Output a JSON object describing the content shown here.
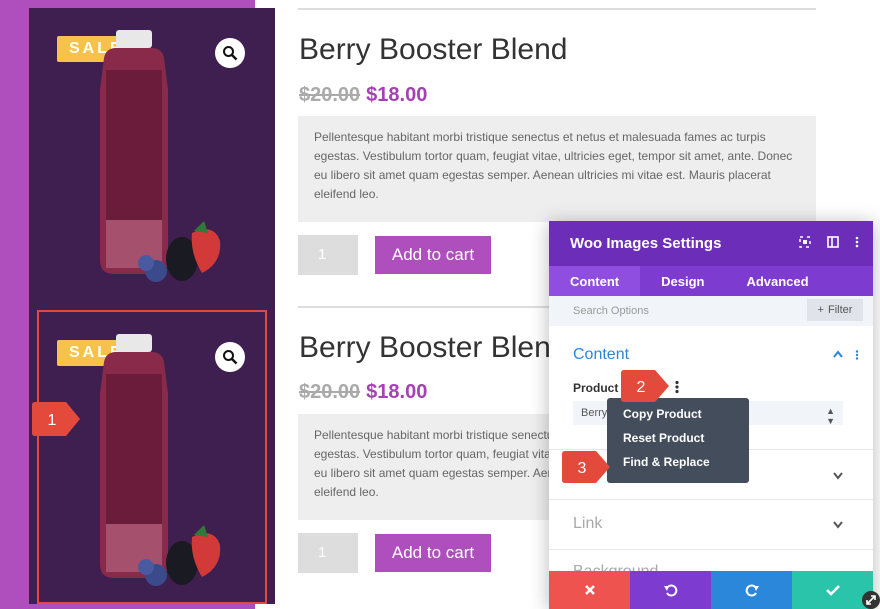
{
  "products": [
    {
      "title": "Berry Booster Blend",
      "old_price": "$20.00",
      "new_price": "$18.00",
      "sale_label": "SALE!",
      "description": "Pellentesque habitant morbi tristique senectus et netus et malesuada fames ac turpis egestas. Vestibulum tortor quam, feugiat vitae, ultricies eget, tempor sit amet, ante. Donec eu libero sit amet quam egestas semper. Aenean ultricies mi vitae est. Mauris placerat eleifend leo.",
      "quantity": "1",
      "add_to_cart": "Add to cart"
    },
    {
      "title": "Berry Booster Blend",
      "old_price": "$20.00",
      "new_price": "$18.00",
      "sale_label": "SALE!",
      "description": "Pellentesque habitant morbi tristique senectus et netus et malesuada fames ac turpis egestas. Vestibulum tortor quam, feugiat vitae, ultricies eget, tempor sit amet, ante. Donec eu libero sit amet quam egestas semper. Aenean ultricies mi vitae est. Mauris placerat eleifend leo.",
      "quantity": "1",
      "add_to_cart": "Add to cart"
    }
  ],
  "settings_panel": {
    "title": "Woo Images Settings",
    "tabs": [
      "Content",
      "Design",
      "Advanced"
    ],
    "active_tab": "Content",
    "search_placeholder": "Search Options",
    "filter_label": "Filter",
    "sections": {
      "content_title": "Content",
      "product_label": "Product",
      "product_value": "Berry",
      "link_title": "Link",
      "background_title": "Background"
    },
    "footer_icons": [
      "close-icon",
      "undo-icon",
      "redo-icon",
      "check-icon"
    ]
  },
  "context_menu": {
    "items": [
      "Copy Product",
      "Reset Product",
      "Find & Replace"
    ]
  },
  "markers": [
    "1",
    "2",
    "3"
  ],
  "colors": {
    "stripe": "#ae4fbd",
    "image_bg": "#3f1f4f",
    "sale_badge": "#f6c24c",
    "price_new": "#a541b4",
    "panel_header": "#6c2eb9",
    "tabs_bg": "#7e3bd0",
    "accent_blue": "#2b87da",
    "marker": "#e44a3c",
    "footer": [
      "#ef5350",
      "#7e3bd0",
      "#2b87da",
      "#29c4a9"
    ]
  }
}
